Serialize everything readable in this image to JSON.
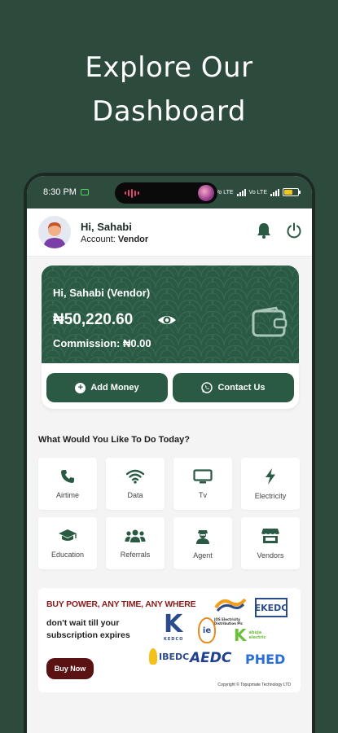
{
  "promo": {
    "line1": "Explore Our",
    "line2": "Dashboard"
  },
  "status_bar": {
    "time": "8:30 PM",
    "net1": "Vo LTE",
    "net2": "Vo LTE"
  },
  "header": {
    "greeting": "Hi, Sahabi",
    "account_label": "Account:",
    "account_type": "Vendor"
  },
  "wallet": {
    "greeting": "Hi, Sahabi (Vendor)",
    "balance": "₦50,220.60",
    "commission": "Commission: ₦0.00"
  },
  "actions": {
    "add_money": "Add Money",
    "contact_us": "Contact Us"
  },
  "services": {
    "title": "What Would You Like To Do Today?",
    "items": [
      {
        "label": "Airtime",
        "icon": "phone-icon"
      },
      {
        "label": "Data",
        "icon": "wifi-icon"
      },
      {
        "label": "Tv",
        "icon": "tv-icon"
      },
      {
        "label": "Electricity",
        "icon": "bolt-icon"
      },
      {
        "label": "Education",
        "icon": "graduation-cap-icon"
      },
      {
        "label": "Referrals",
        "icon": "users-icon"
      },
      {
        "label": "Agent",
        "icon": "agent-icon"
      },
      {
        "label": "Vendors",
        "icon": "store-icon"
      }
    ]
  },
  "banner": {
    "title": "BUY POWER, ANY TIME, ANY WHERE",
    "subtitle": "don't wait till your subscription expires",
    "button": "Buy Now",
    "logos": {
      "kedco": "KEDCO",
      "ekedc": "EKEDC",
      "ibedc": "IBEDC",
      "aedc": "AEDC",
      "phed": "PHED",
      "jos": "JOS Electricity Distribution Plc",
      "abuja": "abuja electric",
      "ie": "ie"
    },
    "copyright": "Copyright © Topupmate Technology LTD"
  },
  "colors": {
    "brand": "#2a5a44",
    "background": "#2d4b3c",
    "banner_accent": "#8a1c1c"
  }
}
